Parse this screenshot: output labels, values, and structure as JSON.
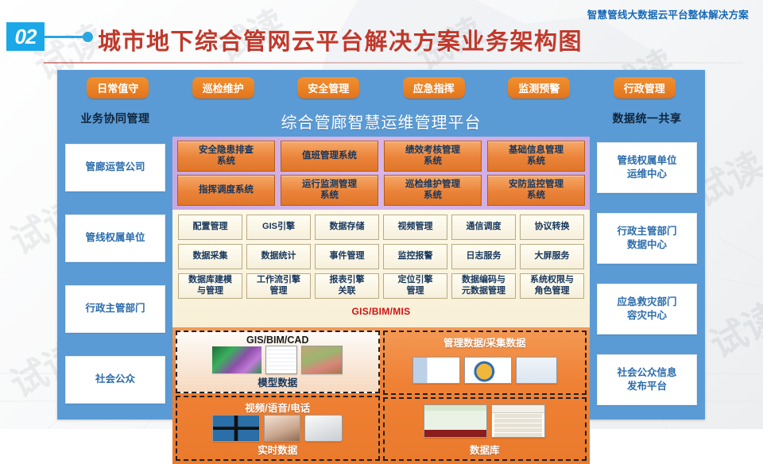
{
  "header": {
    "subtitle": "智慧管线大数据云平台整体解决方案",
    "section_number": "02",
    "title": "城市地下综合管网云平台解决方案业务架构图",
    "watermark": "试读",
    "colors": {
      "badge": "#1aa8e8",
      "title": "#c0392b",
      "subtitle": "#1668b8",
      "panel": "#5b9bd5",
      "pill": "#e2741c",
      "system_band": "#d3b0e4",
      "function_band": "#f8efd6",
      "data_band": "#ef8135"
    }
  },
  "pills": [
    {
      "label": "日常值守"
    },
    {
      "label": "巡检维护"
    },
    {
      "label": "安全管理"
    },
    {
      "label": "应急指挥"
    },
    {
      "label": "监测预警"
    },
    {
      "label": "行政管理"
    }
  ],
  "left_column": {
    "title": "业务协同管理",
    "items": [
      {
        "label": "管廊运营公司"
      },
      {
        "label": "管线权属单位"
      },
      {
        "label": "行政主管部门"
      },
      {
        "label": "社会公众"
      }
    ]
  },
  "right_column": {
    "title": "数据统一共享",
    "items": [
      {
        "label": "管线权属单位\n运维中心",
        "line1": "管线权属单位",
        "line2": "运维中心"
      },
      {
        "label": "行政主管部门\n数据中心",
        "line1": "行政主管部门",
        "line2": "数据中心"
      },
      {
        "label": "应急救灾部门\n容灾中心",
        "line1": "应急救灾部门",
        "line2": "容灾中心"
      },
      {
        "label": "社会公众信息\n发布平台",
        "line1": "社会公众信息",
        "line2": "发布平台"
      }
    ]
  },
  "platform": {
    "title": "综合管廊智慧运维管理平台",
    "systems_row1": [
      {
        "line1": "安全隐患排查",
        "line2": "系统"
      },
      {
        "line1": "值班管理系统",
        "line2": ""
      },
      {
        "line1": "绩效考核管理",
        "line2": "系统"
      },
      {
        "line1": "基础信息管理",
        "line2": "系统"
      }
    ],
    "systems_row2": [
      {
        "line1": "指挥调度系统",
        "line2": ""
      },
      {
        "line1": "运行监测管理",
        "line2": "系统"
      },
      {
        "line1": "巡检维护管理",
        "line2": "系统"
      },
      {
        "line1": "安防监控管理",
        "line2": "系统"
      }
    ]
  },
  "functions": {
    "row1": [
      {
        "line1": "配置管理",
        "line2": ""
      },
      {
        "line1": "GIS引擎",
        "line2": ""
      },
      {
        "line1": "数据存储",
        "line2": ""
      },
      {
        "line1": "视频管理",
        "line2": ""
      },
      {
        "line1": "通信调度",
        "line2": ""
      },
      {
        "line1": "协议转换",
        "line2": ""
      }
    ],
    "row2": [
      {
        "line1": "数据采集",
        "line2": ""
      },
      {
        "line1": "数据统计",
        "line2": ""
      },
      {
        "line1": "事件管理",
        "line2": ""
      },
      {
        "line1": "监控报警",
        "line2": ""
      },
      {
        "line1": "日志服务",
        "line2": ""
      },
      {
        "line1": "大屏服务",
        "line2": ""
      }
    ],
    "row3": [
      {
        "line1": "数据库建模",
        "line2": "与管理"
      },
      {
        "line1": "工作流引擎",
        "line2": "管理"
      },
      {
        "line1": "报表引擎",
        "line2": "关联"
      },
      {
        "line1": "定位引擎",
        "line2": "管理"
      },
      {
        "line1": "数据编码与",
        "line2": "元数据管理"
      },
      {
        "line1": "系统权限与",
        "line2": "角色管理"
      }
    ],
    "band_label": "GIS/BIM/MIS"
  },
  "data_layer": {
    "left": [
      {
        "title": "GIS/BIM/CAD",
        "footer": "模型数据"
      },
      {
        "title": "视频/语音/电话",
        "footer": "实时数据"
      }
    ],
    "right": [
      {
        "title": "管理数据/采集数据",
        "footer": ""
      },
      {
        "title": "",
        "footer": "数据库"
      }
    ],
    "mini_table": {
      "headers": [
        "月份",
        "数值"
      ],
      "rows": [
        [
          "2009年04月",
          "21316"
        ],
        [
          "2009年03月",
          "19537.61"
        ],
        [
          "2009年02月",
          "19120.66"
        ],
        [
          "2009年01月",
          "19134.58"
        ],
        [
          "2008年12月",
          "19460.3"
        ]
      ]
    }
  }
}
